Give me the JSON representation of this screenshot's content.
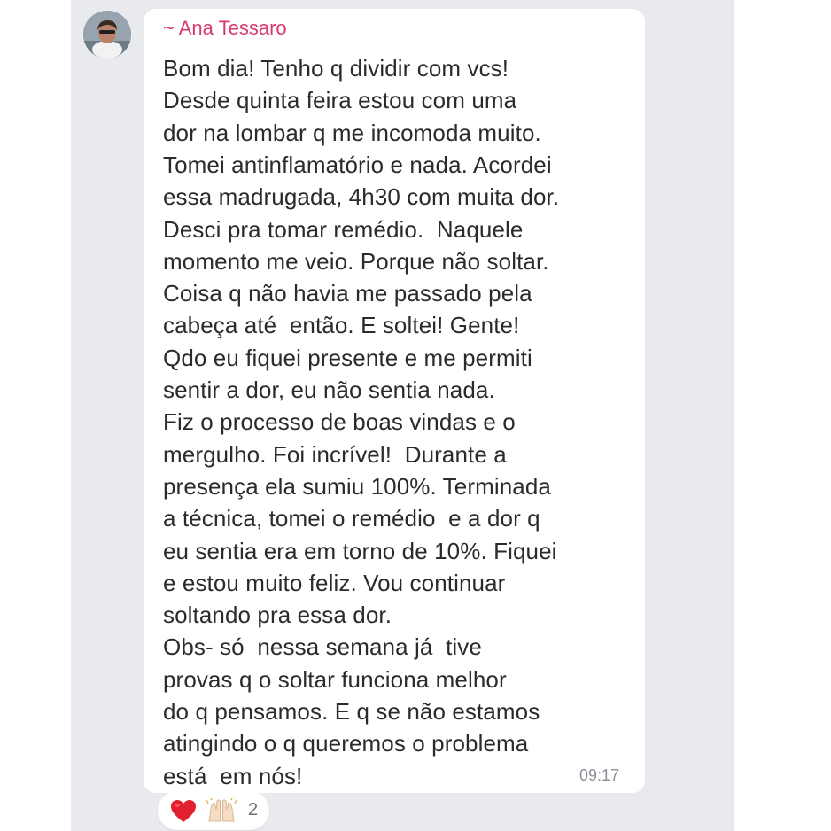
{
  "message": {
    "sender": "~ Ana Tessaro",
    "lines": [
      "Bom dia! Tenho q dividir com vcs!",
      "Desde quinta feira estou com uma",
      "dor na lombar q me incomoda muito.",
      "Tomei antinflamatório e nada. Acordei",
      "essa madrugada, 4h30 com muita dor.",
      "Desci pra tomar remédio.  Naquele",
      "momento me veio. Porque não soltar.",
      "Coisa q não havia me passado pela",
      "cabeça até  então. E soltei! Gente!",
      "Qdo eu fiquei presente e me permiti",
      "sentir a dor, eu não sentia nada.",
      "Fiz o processo de boas vindas e o",
      "mergulho. Foi incrível!  Durante a",
      "presença ela sumiu 100%. Terminada",
      "a técnica, tomei o remédio  e a dor q",
      "eu sentia era em torno de 10%. Fiquei",
      "e estou muito feliz. Vou continuar",
      "soltando pra essa dor.",
      "Obs- só  nessa semana já  tive",
      "provas q o soltar funciona melhor",
      "do q pensamos. E q se não estamos",
      "atingindo o q queremos o problema",
      "está  em nós!"
    ],
    "time": "09:17"
  },
  "reactions": {
    "icons": [
      "heart-icon",
      "raised-hands-icon"
    ],
    "count": "2"
  },
  "colors": {
    "sender": "#d63a6f",
    "text": "#2b2b2b",
    "time": "#8a8f98",
    "chat_background": "#e9eaee",
    "bubble": "#ffffff",
    "heart": "#e0202e"
  }
}
